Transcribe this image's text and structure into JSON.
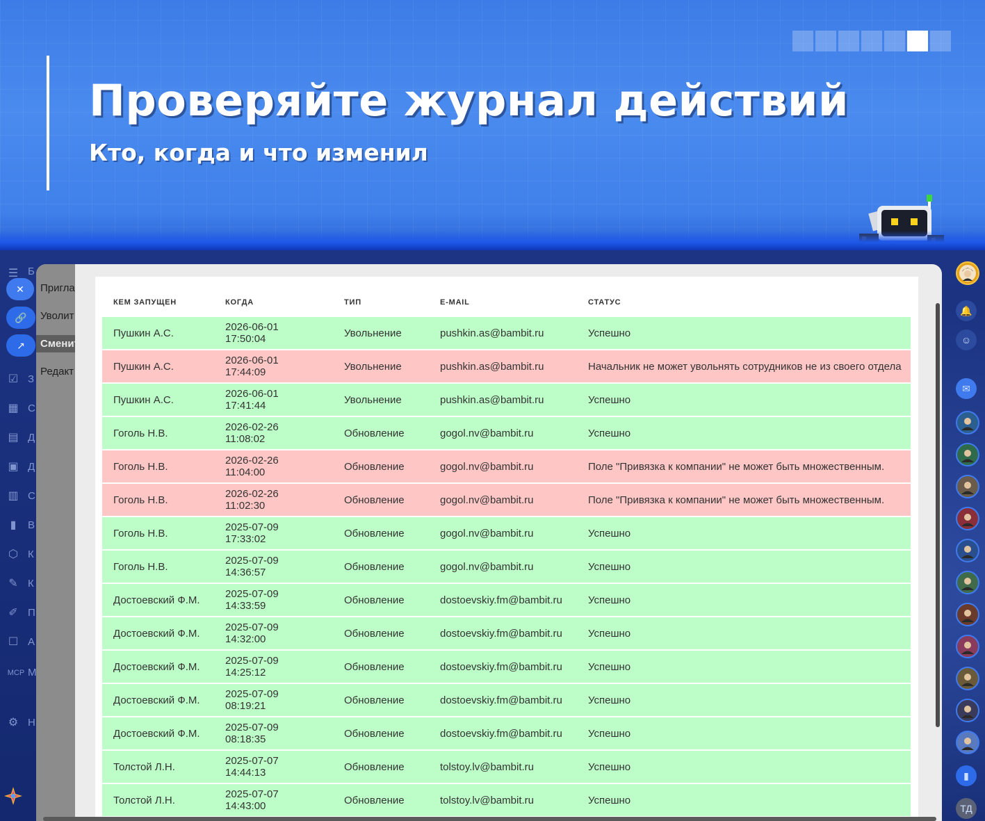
{
  "hero": {
    "title": "Проверяйте журнал действий",
    "subtitle": "Кто, когда и что изменил",
    "pager_count": 7,
    "pager_active": 6
  },
  "left_menu": {
    "rail_letters": [
      "Б",
      "З",
      "С",
      "Д",
      "Д",
      "С",
      "В",
      "К",
      "К",
      "П",
      "А",
      "М",
      "Н"
    ],
    "mcp_label": "MCP",
    "actions": [
      "Пригла",
      "Уволит",
      "Сменит",
      "Редакт"
    ],
    "active_action_index": 2
  },
  "table": {
    "headers": [
      "КЕМ ЗАПУЩЕН",
      "КОГДА",
      "ТИП",
      "E-MAIL",
      "СТАТУС"
    ],
    "rows": [
      {
        "by": "Пушкин А.С.",
        "date": "2026-06-01",
        "time": "17:50:04",
        "type": "Увольнение",
        "email": "pushkin.as@bambit.ru",
        "status": "Успешно",
        "state": "ok"
      },
      {
        "by": "Пушкин А.С.",
        "date": "2026-06-01",
        "time": "17:44:09",
        "type": "Увольнение",
        "email": "pushkin.as@bambit.ru",
        "status": "Начальник не может увольнять сотрудников не из своего отдела",
        "state": "err"
      },
      {
        "by": "Пушкин А.С.",
        "date": "2026-06-01",
        "time": "17:41:44",
        "type": "Увольнение",
        "email": "pushkin.as@bambit.ru",
        "status": "Успешно",
        "state": "ok"
      },
      {
        "by": "Гоголь Н.В.",
        "date": "2026-02-26",
        "time": "11:08:02",
        "type": "Обновление",
        "email": "gogol.nv@bambit.ru",
        "status": "Успешно",
        "state": "ok"
      },
      {
        "by": "Гоголь Н.В.",
        "date": "2026-02-26",
        "time": "11:04:00",
        "type": "Обновление",
        "email": "gogol.nv@bambit.ru",
        "status": "Поле \"Привязка к компании\" не может быть множественным.",
        "state": "err"
      },
      {
        "by": "Гоголь Н.В.",
        "date": "2026-02-26",
        "time": "11:02:30",
        "type": "Обновление",
        "email": "gogol.nv@bambit.ru",
        "status": "Поле \"Привязка к компании\" не может быть множественным.",
        "state": "err"
      },
      {
        "by": "Гоголь Н.В.",
        "date": "2025-07-09",
        "time": "17:33:02",
        "type": "Обновление",
        "email": "gogol.nv@bambit.ru",
        "status": "Успешно",
        "state": "ok"
      },
      {
        "by": "Гоголь Н.В.",
        "date": "2025-07-09",
        "time": "14:36:57",
        "type": "Обновление",
        "email": "gogol.nv@bambit.ru",
        "status": "Успешно",
        "state": "ok"
      },
      {
        "by": "Достоевский Ф.М.",
        "date": "2025-07-09",
        "time": "14:33:59",
        "type": "Обновление",
        "email": "dostoevskiy.fm@bambit.ru",
        "status": "Успешно",
        "state": "ok"
      },
      {
        "by": "Достоевский Ф.М.",
        "date": "2025-07-09",
        "time": "14:32:00",
        "type": "Обновление",
        "email": "dostoevskiy.fm@bambit.ru",
        "status": "Успешно",
        "state": "ok"
      },
      {
        "by": "Достоевский Ф.М.",
        "date": "2025-07-09",
        "time": "14:25:12",
        "type": "Обновление",
        "email": "dostoevskiy.fm@bambit.ru",
        "status": "Успешно",
        "state": "ok"
      },
      {
        "by": "Достоевский Ф.М.",
        "date": "2025-07-09",
        "time": "08:19:21",
        "type": "Обновление",
        "email": "dostoevskiy.fm@bambit.ru",
        "status": "Успешно",
        "state": "ok"
      },
      {
        "by": "Достоевский Ф.М.",
        "date": "2025-07-09",
        "time": "08:18:35",
        "type": "Обновление",
        "email": "dostoevskiy.fm@bambit.ru",
        "status": "Успешно",
        "state": "ok"
      },
      {
        "by": "Толстой Л.Н.",
        "date": "2025-07-07",
        "time": "14:44:13",
        "type": "Обновление",
        "email": "tolstoy.lv@bambit.ru",
        "status": "Успешно",
        "state": "ok"
      },
      {
        "by": "Толстой Л.Н.",
        "date": "2025-07-07",
        "time": "14:43:00",
        "type": "Обновление",
        "email": "tolstoy.lv@bambit.ru",
        "status": "Успешно",
        "state": "ok"
      }
    ]
  },
  "right_rail": {
    "user_initials": "ТД",
    "avatar_colors": [
      "#2a5f8f",
      "#2f6b4a",
      "#6b5b4a",
      "#8a2f3a",
      "#2a4f8f",
      "#3f6b4a",
      "#6a3a2a",
      "#8a3a5a",
      "#6a5a3a",
      "#3a3a5a",
      "#5a7abf"
    ]
  },
  "colors": {
    "success_row": "#bdfdc8",
    "error_row": "#ffc6c6",
    "accent": "#2e6be8"
  }
}
